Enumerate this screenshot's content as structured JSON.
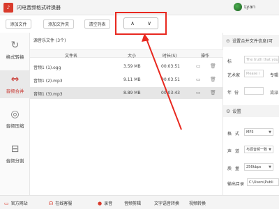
{
  "app": {
    "title": "闪电音频格式转换器",
    "user": "Lyan"
  },
  "toolbar": {
    "add_file": "添加文件",
    "add_folder": "添加文件夹",
    "clear_list": "清空列表",
    "up_label": "∧",
    "down_label": "∨"
  },
  "sidebar": {
    "items": [
      {
        "label": "格式转换",
        "icon": "↻"
      },
      {
        "label": "音频合并",
        "icon": "⇔"
      },
      {
        "label": "音频压缩",
        "icon": "◎"
      },
      {
        "label": "音频分割",
        "icon": "⊟"
      }
    ]
  },
  "filelist": {
    "title": "源音乐文件 (3个)",
    "headers": {
      "name": "文件名",
      "size": "大小",
      "duration": "时长(S)",
      "ops": "操作"
    },
    "rows": [
      {
        "name": "音频1 (1).ogg",
        "size": "3.59 MB",
        "duration": "00:03:51"
      },
      {
        "name": "音频1 (2).mp3",
        "size": "9.11 MB",
        "duration": "00:03:51"
      },
      {
        "name": "音频1 (3).mp3",
        "size": "8.89 MB",
        "duration": "00:03:43"
      }
    ]
  },
  "info_panel": {
    "title": "设置合并文件信息(可",
    "title_label": "标",
    "title_placeholder": "The truth that you",
    "artist_label": "艺术家",
    "artist_placeholder": "Please i",
    "album_label": "专辑",
    "year_label": "年",
    "year_sublabel": "份",
    "year_placeholder": "",
    "genre_label": "流派"
  },
  "settings_panel": {
    "title": "设置",
    "format_label": "格",
    "format_sublabel": "式",
    "format_value": "MP3",
    "channel_label": "声",
    "channel_sublabel": "道",
    "channel_value": "与源音频一致",
    "quality_label": "质",
    "quality_sublabel": "量",
    "quality_value": "256kbps",
    "output_label": "输出目录",
    "output_value": "C:\\Users\\Publi"
  },
  "bottombar": {
    "items": [
      {
        "label": "官方网站",
        "icon": "▭"
      },
      {
        "label": "在线客服",
        "icon": "☊"
      },
      {
        "label": "录音",
        "icon": "●"
      },
      {
        "label": "音频剪辑",
        "icon": ""
      },
      {
        "label": "文字语音转换",
        "icon": ""
      },
      {
        "label": "视频转换",
        "icon": ""
      }
    ]
  },
  "colors": {
    "accent": "#c8322b",
    "annotation": "#e8281f"
  }
}
